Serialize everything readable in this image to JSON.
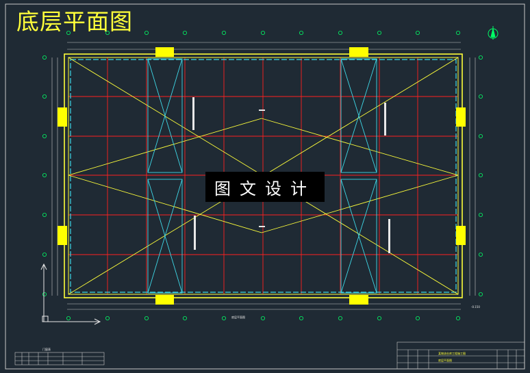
{
  "drawing": {
    "title": "底层平面图",
    "watermark": "图文设计",
    "plan_caption": "底层平面图",
    "elevation_mark": "-0.150",
    "title_block": {
      "project": "某物流仓库工程施工图",
      "sheet": "底层平面图"
    },
    "door_table_title": "门窗表"
  },
  "colors": {
    "background": "#1f2a34",
    "grid": "#ff2020",
    "wall": "#ffff3a",
    "stair": "#3fd9e8",
    "door": "#ffff00",
    "annotation": "#e8e8e8",
    "dimension": "#00ff66"
  },
  "icons": [
    "north-arrow-icon",
    "coordinate-axis-icon"
  ]
}
